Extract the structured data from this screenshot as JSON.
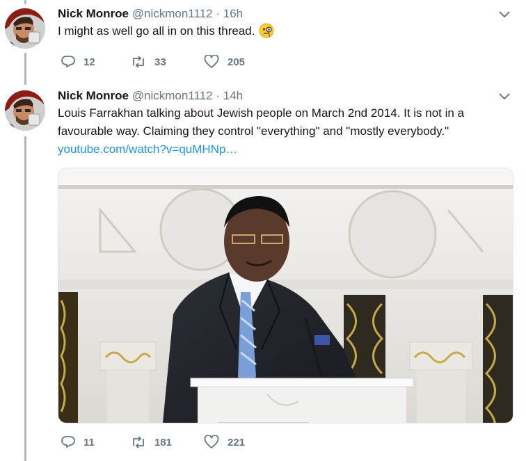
{
  "tweets": [
    {
      "display_name": "Nick Monroe",
      "handle": "@nickmon1112",
      "separator": "·",
      "time": "16h",
      "text": "I might as well go all in on this thread.",
      "emoji_icon": "monocle-face-emoji",
      "replies": "12",
      "retweets": "33",
      "likes": "205"
    },
    {
      "display_name": "Nick Monroe",
      "handle": "@nickmon1112",
      "separator": "·",
      "time": "14h",
      "text_line1": "Louis Farrakhan talking about Jewish people on March 2nd 2014. It is not in a",
      "text_line2": "favourable way. Claiming they control \"everything\" and \"mostly everybody.\"",
      "link": "youtube.com/watch?v=quMHNp…",
      "media_icon": "video-thumbnail",
      "replies": "11",
      "retweets": "181",
      "likes": "221"
    }
  ],
  "colors": {
    "text": "#14171a",
    "secondary": "#657786",
    "link": "#1b95e0",
    "thread_line": "#aab8c2",
    "border": "#e1e8ed"
  }
}
